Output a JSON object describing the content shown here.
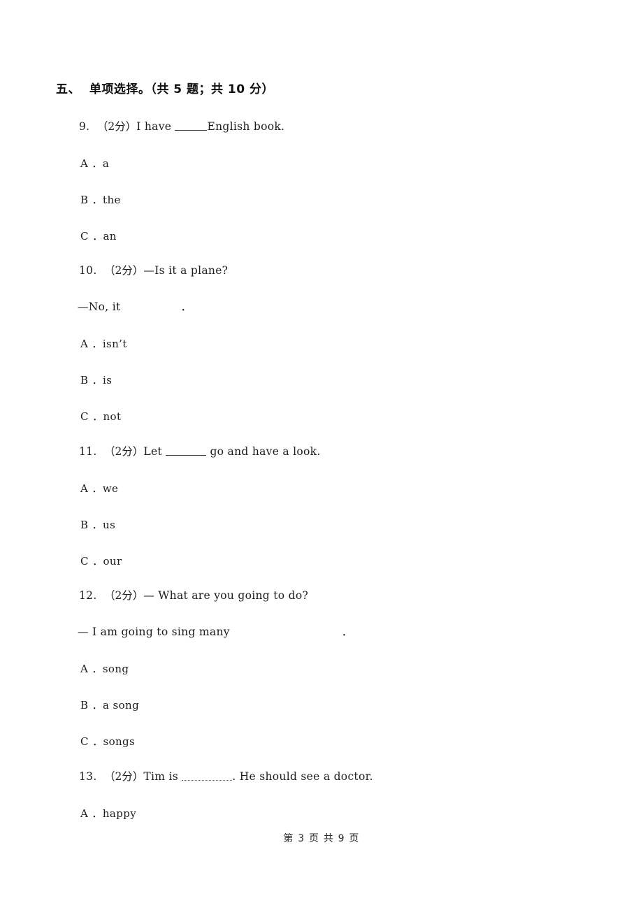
{
  "section": {
    "header": "五、  单项选择。（共 5 题；共 10 分）"
  },
  "questions": [
    {
      "number": "9.",
      "marks": "（2分）",
      "stem_before": "I have ",
      "stem_after": "English book.",
      "blank_style": "solid",
      "second_line": null,
      "options": [
        {
          "letter": "A",
          "sep": "．",
          "text": "a"
        },
        {
          "letter": "B",
          "sep": "．",
          "text": "the"
        },
        {
          "letter": "C",
          "sep": "．",
          "text": "an"
        }
      ]
    },
    {
      "number": "10.",
      "marks": "（2分）",
      "stem_before": "—Is it a plane?",
      "stem_after": "",
      "blank_style": "none",
      "second_line": {
        "before": "—No, it",
        "after": "．"
      },
      "options": [
        {
          "letter": "A",
          "sep": "．",
          "text": "isn’t"
        },
        {
          "letter": "B",
          "sep": "．",
          "text": "is"
        },
        {
          "letter": "C",
          "sep": "．",
          "text": "not"
        }
      ]
    },
    {
      "number": "11.",
      "marks": "（2分）",
      "stem_before": "Let ",
      "stem_after": " go and have a look.",
      "blank_style": "solid",
      "second_line": null,
      "options": [
        {
          "letter": "A",
          "sep": "．",
          "text": "we"
        },
        {
          "letter": "B",
          "sep": "．",
          "text": "us"
        },
        {
          "letter": "C",
          "sep": "．",
          "text": "our"
        }
      ]
    },
    {
      "number": "12.",
      "marks": "（2分）",
      "stem_before": "— What are you going to do?",
      "stem_after": "",
      "blank_style": "none",
      "second_line": {
        "before": "— I am going to sing many",
        "after": "．"
      },
      "options": [
        {
          "letter": "A",
          "sep": "．",
          "text": "song"
        },
        {
          "letter": "B",
          "sep": "．",
          "text": "a song"
        },
        {
          "letter": "C",
          "sep": "．",
          "text": "songs"
        }
      ]
    },
    {
      "number": "13.",
      "marks": "（2分）",
      "stem_before": "Tim is ",
      "stem_after": ". He should see a doctor.",
      "blank_style": "dotted",
      "second_line": null,
      "options": [
        {
          "letter": "A",
          "sep": "．",
          "text": "happy"
        }
      ]
    }
  ],
  "footer": {
    "page_text": "第 3 页 共 9 页"
  }
}
